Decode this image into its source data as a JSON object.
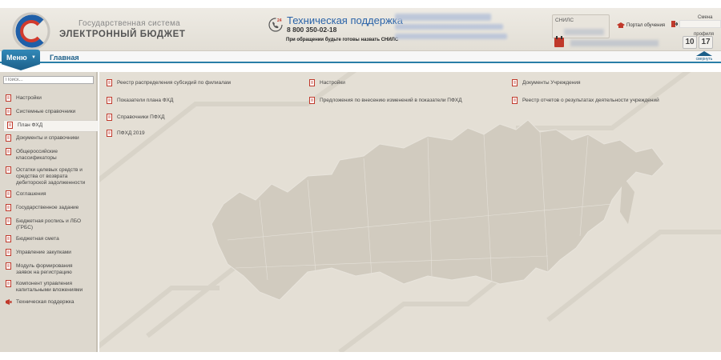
{
  "header": {
    "brand_line1": "Государственная система",
    "brand_line2": "ЭЛЕКТРОННЫЙ БЮДЖЕТ",
    "support_title": "Техническая поддержка",
    "support_phone": "8 800 350-02-18",
    "support_note": "При обращении будьте готовы назвать СНИЛС",
    "support_badge": "24",
    "snils_label": "СНИЛС",
    "portal_label": "Портал обучения",
    "change_profile_1": "Смена",
    "change_profile_2": "профиля",
    "clock_hours": "10",
    "clock_minutes": "17"
  },
  "menubar": {
    "menu_label": "Меню",
    "home_label": "Главная",
    "collapse_label": "свернуть"
  },
  "sidebar": {
    "search_placeholder": "Поиск...",
    "items": [
      {
        "label": "Настройки"
      },
      {
        "label": "Системные справочники"
      },
      {
        "label": "План ФХД"
      },
      {
        "label": "Документы и справочники"
      },
      {
        "label": "Общероссийские классификаторы"
      },
      {
        "label": "Остатки целевых средств и средства от возврата дебиторской задолженности"
      },
      {
        "label": "Соглашения"
      },
      {
        "label": "Государственное задание"
      },
      {
        "label": "Бюджетная роспись и ЛБО (ГРБС)"
      },
      {
        "label": "Бюджетная смета"
      },
      {
        "label": "Управление закупками"
      },
      {
        "label": "Модуль формирования заявок на регистрацию"
      },
      {
        "label": "Компонент управления капитальными вложениями"
      },
      {
        "label": "Техническая поддержка"
      }
    ]
  },
  "main": {
    "links": [
      {
        "label": "Реестр распределения субсидий по филиалам"
      },
      {
        "label": "Показатели плана ФХД"
      },
      {
        "label": "Справочники ПФХД"
      },
      {
        "label": "ПФХД 2019"
      },
      {
        "label": "Настройки"
      },
      {
        "label": "Предложения по внесению изменений в показатели ПФХД"
      },
      {
        "label": "Документы Учреждения"
      },
      {
        "label": "Реестр отчетов о результатах деятельности учреждений"
      }
    ]
  },
  "colors": {
    "accent": "#2a7fa8",
    "menu_button": "#1c5f89",
    "support_title": "#2a63a8",
    "icon_red": "#c0392b"
  }
}
